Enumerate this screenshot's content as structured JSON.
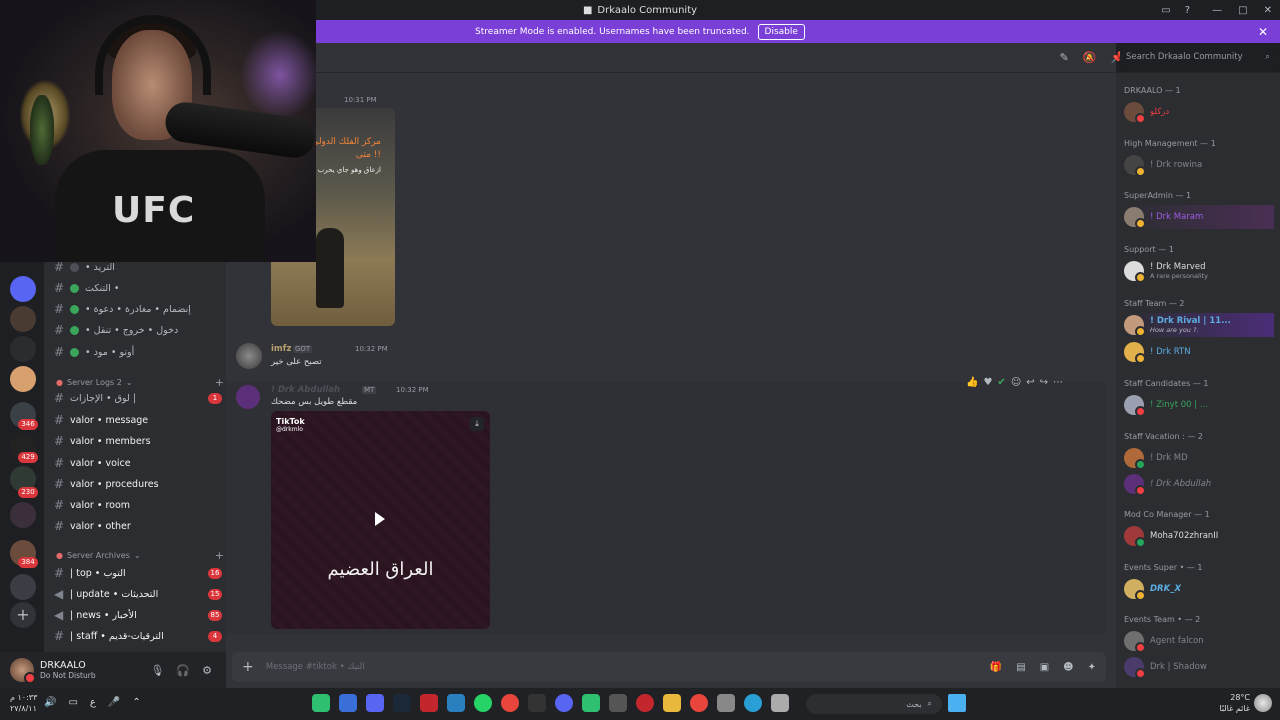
{
  "window": {
    "title": "Drkaalo Community"
  },
  "banner": {
    "text": "Streamer Mode is enabled. Usernames have been truncated.",
    "disable_label": "Disable"
  },
  "search": {
    "placeholder": "Search Drkaalo Community"
  },
  "rail_badges": [
    "346",
    "429",
    "230",
    "384"
  ],
  "channels": [
    {
      "label": "• التريد",
      "dot": "gray"
    },
    {
      "label": "التنكت •",
      "dot": "green"
    },
    {
      "label": "• إنضمام • مغادرة • دعوة",
      "dot": "green"
    },
    {
      "label": "• دخول • خروج • تنقل",
      "dot": "green"
    },
    {
      "label": "• أوتو • مود",
      "dot": "green"
    }
  ],
  "categories": {
    "logs": "Server Logs 2",
    "archives": "Server Archives"
  },
  "log_channels": [
    {
      "label": "لوق • الإجازات |",
      "count": "1"
    },
    {
      "label": "valor • message",
      "count": ""
    },
    {
      "label": "valor • members",
      "count": ""
    },
    {
      "label": "valor • voice",
      "count": ""
    },
    {
      "label": "valor • procedures",
      "count": ""
    },
    {
      "label": "valor • room",
      "count": ""
    },
    {
      "label": "valor • other",
      "count": ""
    }
  ],
  "archive_channels": [
    {
      "label": "| top • التوب",
      "count": "16"
    },
    {
      "label": "| update • التحديثات",
      "count": "15"
    },
    {
      "label": "| news • الأخبار",
      "count": "85"
    },
    {
      "label": "| staff • الترقيات-قديم",
      "count": "4"
    }
  ],
  "user": {
    "name": "DRKAALO",
    "status": "Do Not Disturb"
  },
  "messages": {
    "m1": {
      "time": "10:31 PM",
      "img_text": "مركز الفلك الدولي و مايدرون متى !!",
      "img_sub": "ازعاق وهو جاي يحرب ط"
    },
    "m2": {
      "author": "imfz",
      "tag": "GOT",
      "time": "10:32 PM",
      "text": "تصبح على خير"
    },
    "m3": {
      "author": "! Drk Abdullah",
      "tag": "MT",
      "time": "10:32 PM",
      "text": "مقطع طويل بس مضحك",
      "video_brand": "TikTok",
      "video_handle": "@drkmlo",
      "video_caption": "العراق العضيم"
    }
  },
  "composer": {
    "placeholder": "Message #tiktok • التيك"
  },
  "members": {
    "groups": [
      {
        "label": "DRKAALO — 1"
      },
      {
        "label": "High Management — 1"
      },
      {
        "label": "SuperAdmin — 1"
      },
      {
        "label": "Support — 1"
      },
      {
        "label": "Staff Team — 2"
      },
      {
        "label": "Staff Candidates — 1"
      },
      {
        "label": "Staff Vacation : — 2"
      },
      {
        "label": "Mod Co Manager — 1"
      },
      {
        "label": "Events Super • — 1"
      },
      {
        "label": "Events Team • — 2"
      }
    ],
    "list": [
      {
        "name": "دركلو",
        "sub": "",
        "color": "#f23f43"
      },
      {
        "name": "! Drk rowina",
        "sub": "",
        "color": "#80848e"
      },
      {
        "name": "! Drk Maram",
        "sub": "",
        "color": "#9b5de5"
      },
      {
        "name": "! Drk Marved",
        "sub": "A rare personality",
        "color": "#dbdee1"
      },
      {
        "name": "! Drk Rival | 11...",
        "sub": "How are you ?.",
        "color": "#5dade2"
      },
      {
        "name": "! Drk RTN",
        "sub": "",
        "color": "#5dade2"
      },
      {
        "name": "! Zinyt 00 | ...",
        "sub": "",
        "color": "#3ba55c"
      },
      {
        "name": "! Drk MD",
        "sub": "",
        "color": "#80848e"
      },
      {
        "name": "! Drk Abdullah",
        "sub": "",
        "color": "#80848e"
      },
      {
        "name": "Moha702zhranII",
        "sub": "",
        "color": "#dbdee1"
      },
      {
        "name": "DRK_X",
        "sub": "",
        "color": "#5dade2"
      },
      {
        "name": "Agent falcon",
        "sub": "",
        "color": "#80848e"
      },
      {
        "name": "Drk | Shadow",
        "sub": "",
        "color": "#80848e"
      }
    ]
  },
  "taskbar": {
    "time": "١٠:٣٣ م",
    "date": "٢٧/٨/١١",
    "search": "بحث",
    "temp": "28°C",
    "weather": "غائم غالبًا",
    "lang": "ع"
  }
}
